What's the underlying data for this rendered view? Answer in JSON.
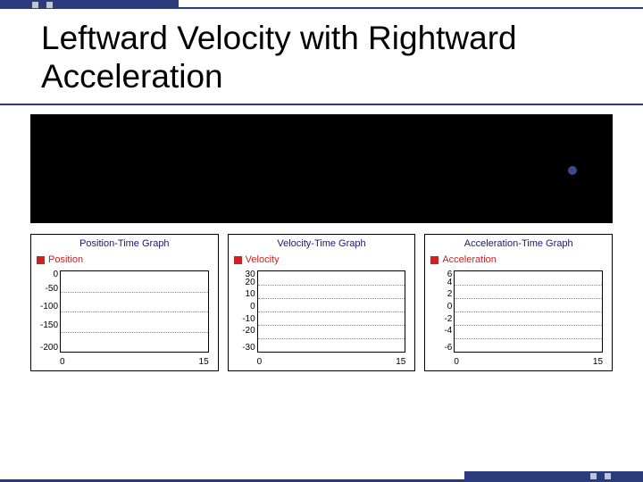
{
  "slide": {
    "title": "Leftward Velocity with Rightward Acceleration"
  },
  "charts": [
    {
      "title": "Position-Time Graph",
      "legend": "Position"
    },
    {
      "title": "Velocity-Time Graph",
      "legend": "Velocity"
    },
    {
      "title": "Acceleration-Time Graph",
      "legend": "Acceleration"
    }
  ],
  "chart_data": [
    {
      "type": "line",
      "title": "Position-Time Graph",
      "series_name": "Position",
      "x": [],
      "values": [],
      "xlabel": "",
      "ylabel": "",
      "xlim": [
        0,
        15
      ],
      "ylim": [
        -200,
        0
      ],
      "yticks": [
        0,
        -50,
        -100,
        -150,
        -200
      ],
      "xticks": [
        0,
        15
      ]
    },
    {
      "type": "line",
      "title": "Velocity-Time Graph",
      "series_name": "Velocity",
      "x": [],
      "values": [],
      "xlabel": "",
      "ylabel": "",
      "xlim": [
        0,
        15
      ],
      "ylim": [
        -30,
        30
      ],
      "yticks": [
        30,
        20,
        10,
        0,
        -10,
        -20,
        -30
      ],
      "xticks": [
        0,
        15
      ]
    },
    {
      "type": "line",
      "title": "Acceleration-Time Graph",
      "series_name": "Acceleration",
      "x": [],
      "values": [],
      "xlabel": "",
      "ylabel": "",
      "xlim": [
        0,
        15
      ],
      "ylim": [
        -6,
        6
      ],
      "yticks": [
        6,
        4,
        2,
        0,
        -2,
        -4,
        -6
      ],
      "xticks": [
        0,
        15
      ]
    }
  ]
}
